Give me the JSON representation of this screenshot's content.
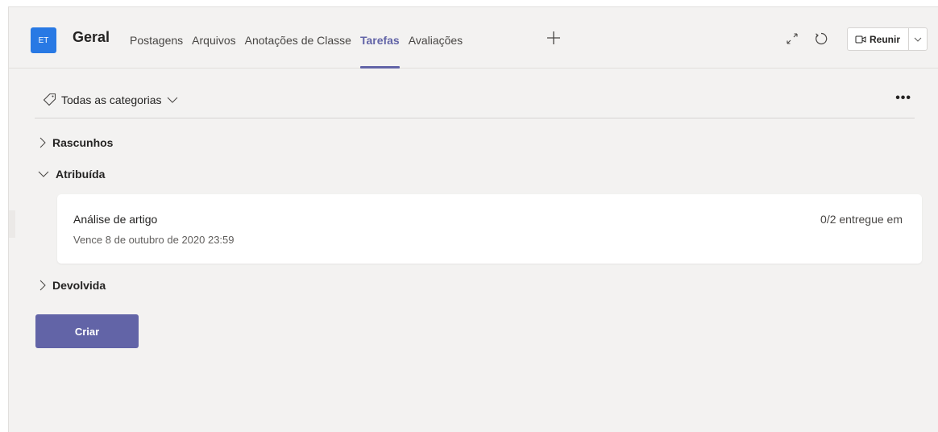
{
  "header": {
    "team_initials": "ET",
    "channel_name": "Geral",
    "tabs": [
      {
        "label": "Postagens"
      },
      {
        "label": "Arquivos"
      },
      {
        "label": "Anotações de Classe"
      },
      {
        "label": "Tarefas",
        "active": true
      },
      {
        "label": "Avaliações"
      }
    ],
    "meet_label": "Reunir"
  },
  "filter": {
    "label": "Todas as categorias",
    "more": "•••"
  },
  "sections": {
    "drafts": "Rascunhos",
    "assigned": "Atribuída",
    "returned": "Devolvida"
  },
  "assignment": {
    "title": "Análise de artigo",
    "due": "Vence 8 de outubro de 2020 23:59",
    "status": "0/2 entregue em"
  },
  "create_label": "Criar",
  "colors": {
    "accent": "#6264a7",
    "avatar": "#2879e4",
    "background": "#f3f2f1"
  }
}
